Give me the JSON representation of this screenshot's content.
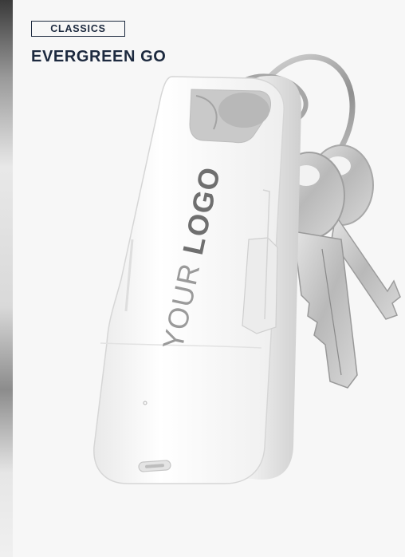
{
  "card": {
    "category_label": "CLASSICS",
    "product_name": "EVERGREEN GO"
  },
  "product": {
    "engraving_light": "YOUR ",
    "engraving_bold": "LOGO"
  }
}
